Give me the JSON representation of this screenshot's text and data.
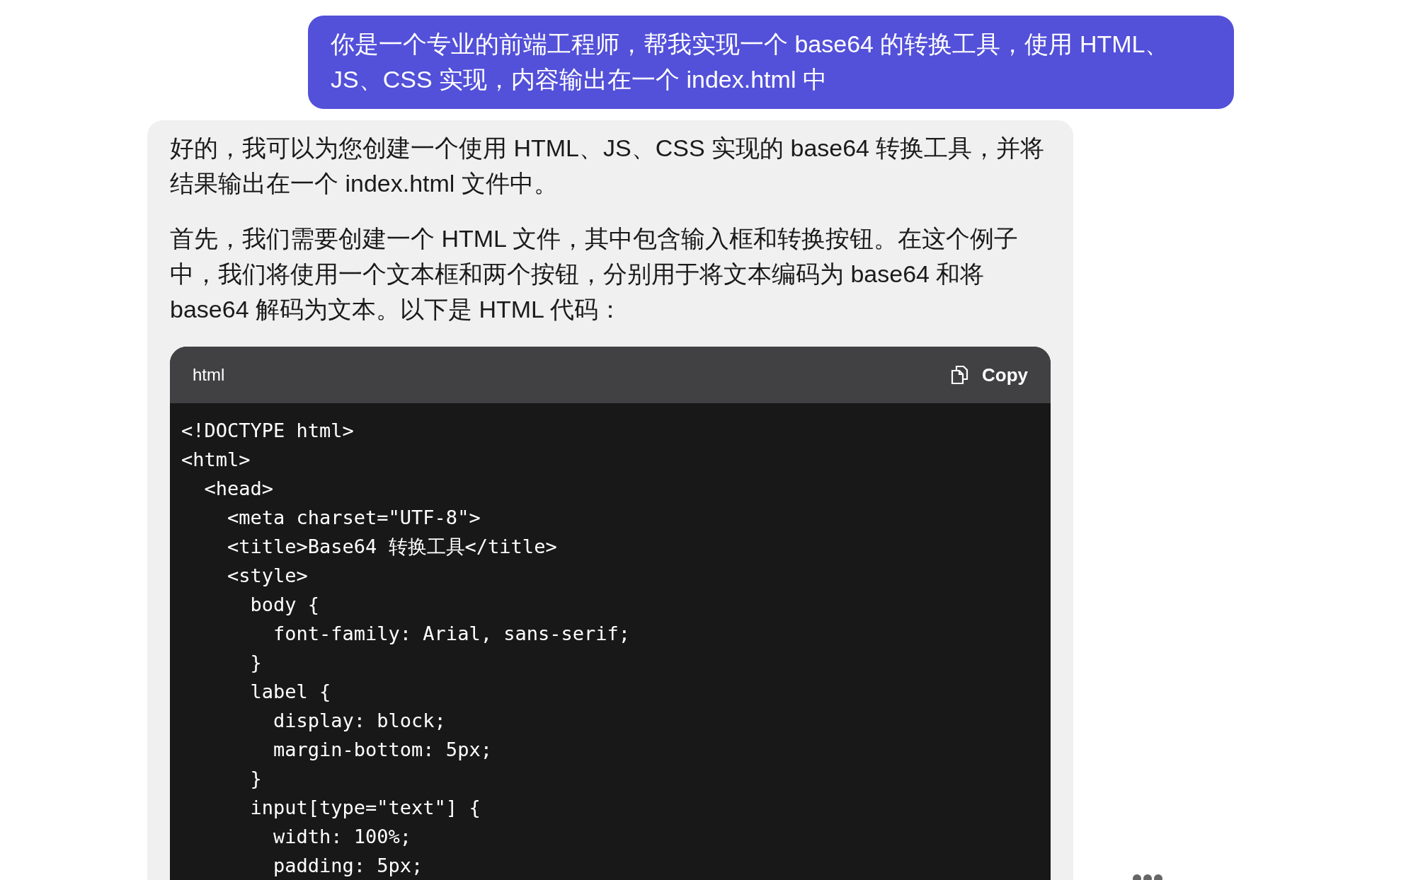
{
  "user_message": {
    "text": "你是一个专业的前端工程师，帮我实现一个 base64 的转换工具，使用 HTML、JS、CSS 实现，内容输出在一个 index.html 中"
  },
  "assistant_message": {
    "paragraphs": [
      "好的，我可以为您创建一个使用 HTML、JS、CSS 实现的 base64 转换工具，并将结果输出在一个 index.html 文件中。",
      "首先，我们需要创建一个 HTML 文件，其中包含输入框和转换按钮。在这个例子中，我们将使用一个文本框和两个按钮，分别用于将文本编码为 base64 和将 base64 解码为文本。以下是 HTML 代码："
    ],
    "code_block": {
      "language": "html",
      "copy_label": "Copy",
      "lines": [
        "<!DOCTYPE html>",
        "<html>",
        "  <head>",
        "    <meta charset=\"UTF-8\">",
        "    <title>Base64 转换工具</title>",
        "    <style>",
        "      body {",
        "        font-family: Arial, sans-serif;",
        "      }",
        "      label {",
        "        display: block;",
        "        margin-bottom: 5px;",
        "      }",
        "      input[type=\"text\"] {",
        "        width: 100%;",
        "        padding: 5px;"
      ]
    }
  }
}
